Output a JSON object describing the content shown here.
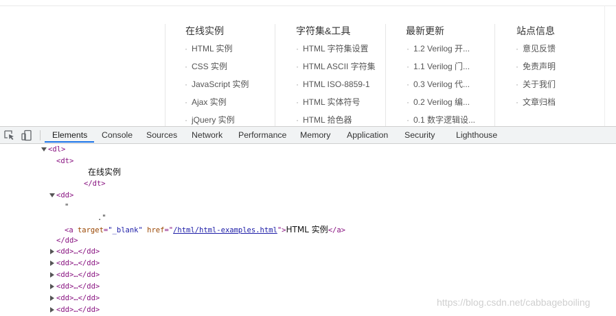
{
  "site": {
    "columns": [
      {
        "title": "在线实例",
        "items": [
          "HTML 实例",
          "CSS 实例",
          "JavaScript 实例",
          "Ajax 实例",
          "jQuery 实例"
        ]
      },
      {
        "title": "字符集&工具",
        "items": [
          "HTML 字符集设置",
          "HTML ASCII 字符集",
          "HTML ISO-8859-1",
          "HTML 实体符号",
          "HTML 拾色器"
        ]
      },
      {
        "title": "最新更新",
        "items": [
          "1.2 Verilog 开...",
          "1.1 Verilog 门...",
          "0.3 Verilog 代...",
          "0.2 Verilog 编...",
          "0.1 数字逻辑设..."
        ]
      },
      {
        "title": "站点信息",
        "items": [
          "意见反馈",
          "免责声明",
          "关于我们",
          "文章归档"
        ]
      }
    ],
    "bullet": "·"
  },
  "devtools": {
    "tabs": [
      "Elements",
      "Console",
      "Sources",
      "Network",
      "Performance",
      "Memory",
      "Application",
      "Security",
      "Lighthouse"
    ],
    "active_tab": "Elements",
    "icons": [
      "inspect-element-icon",
      "device-toolbar-icon"
    ]
  },
  "dom": {
    "dl_open": "<dl>",
    "dt_open": "<dt>",
    "dt_text": "在线实例",
    "dt_close": "</dt>",
    "dd_open": "<dd>",
    "quote_line1": "\"",
    "quote_line2": ".\"",
    "a_open_start": "<a ",
    "a_target_name": "target",
    "a_target_value": "\"_blank\"",
    "a_href_name": "href",
    "a_href_value": "/html/html-examples.html",
    "a_text": "HTML 实例",
    "a_close": "</a>",
    "dd_close": "</dd>",
    "collapsed_dd": "<dd>…</dd>",
    "collapsed_count": 6
  },
  "watermark": "https://blog.csdn.net/cabbageboiling",
  "colors": {
    "tag": "#881280",
    "attr_name": "#994500",
    "attr_value": "#1a1aa6",
    "active_tab_underline": "#1a73e8"
  }
}
